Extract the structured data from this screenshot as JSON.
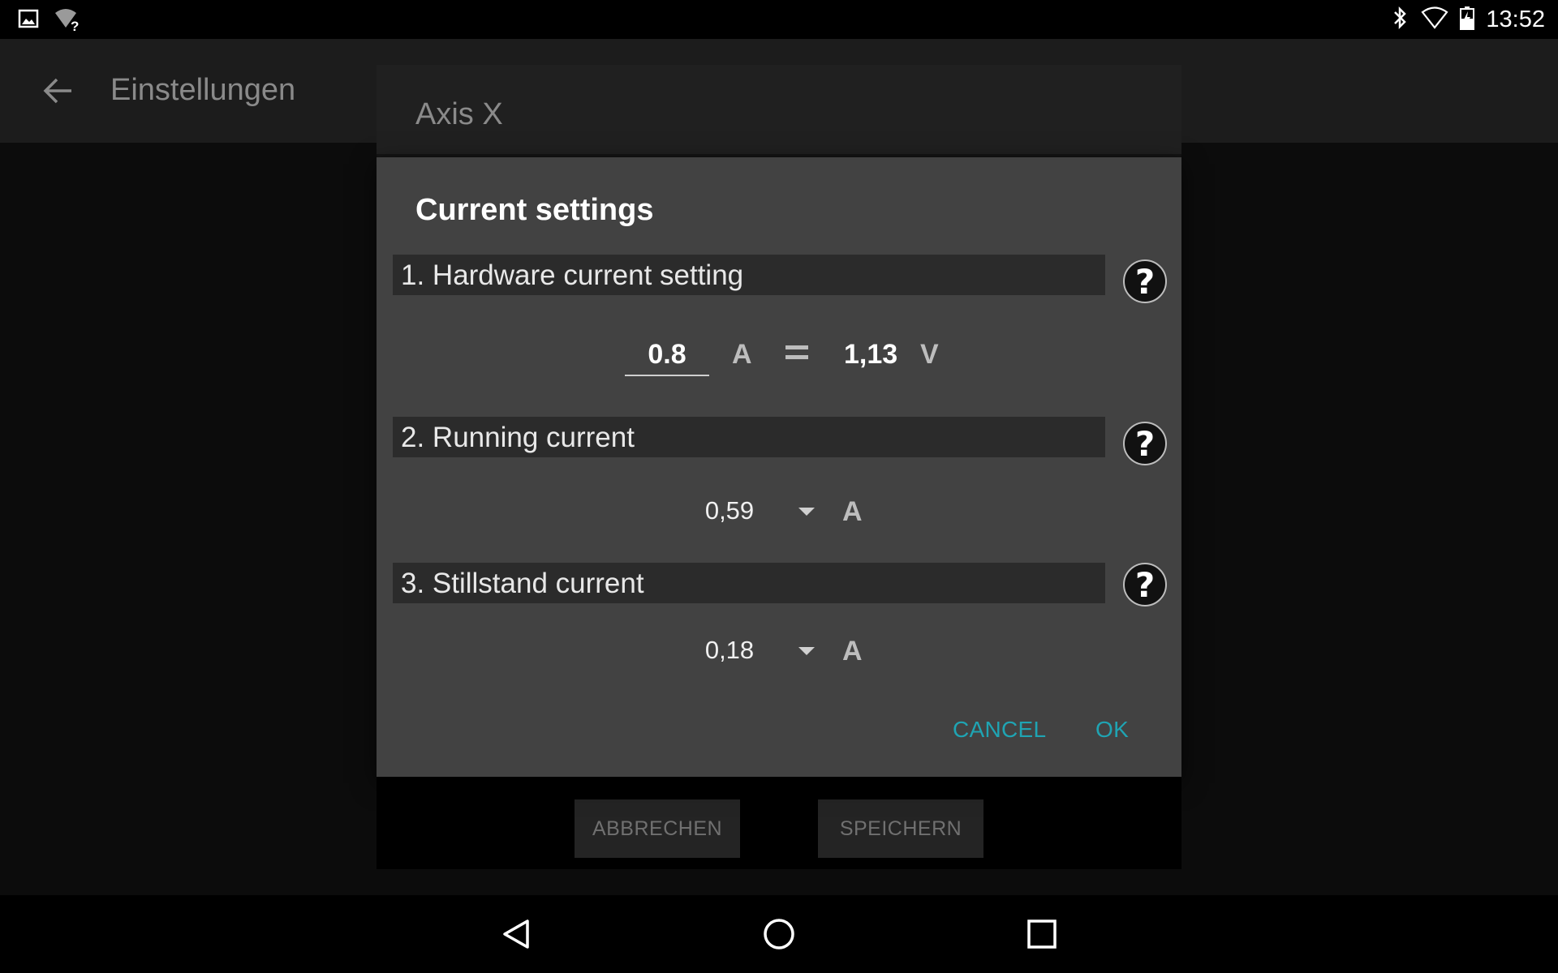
{
  "status_bar": {
    "time": "13:52",
    "left_icons": [
      "image-icon",
      "wifi-unknown-icon"
    ],
    "right_icons": [
      "bluetooth-icon",
      "wifi-icon",
      "battery-icon"
    ]
  },
  "app_bar": {
    "title": "Einstellungen"
  },
  "background_dialog": {
    "title": "Axis X",
    "buttons": {
      "cancel_label": "ABBRECHEN",
      "save_label": "SPEICHERN"
    }
  },
  "dialog": {
    "title": "Current settings",
    "sections": {
      "hardware": {
        "label": "1. Hardware current setting",
        "current_value": "0.8",
        "current_unit": "A",
        "voltage_value": "1,13",
        "voltage_unit": "V"
      },
      "running": {
        "label": "2. Running current",
        "selected_value": "0,59",
        "unit": "A"
      },
      "stillstand": {
        "label": "3. Stillstand current",
        "selected_value": "0,18",
        "unit": "A"
      }
    },
    "help_label": "?",
    "buttons": {
      "cancel_label": "CANCEL",
      "ok_label": "OK"
    }
  },
  "colors": {
    "accent": "#1fa4b3",
    "dialog_bg": "#424242",
    "section_bg": "#2b2b2b"
  }
}
